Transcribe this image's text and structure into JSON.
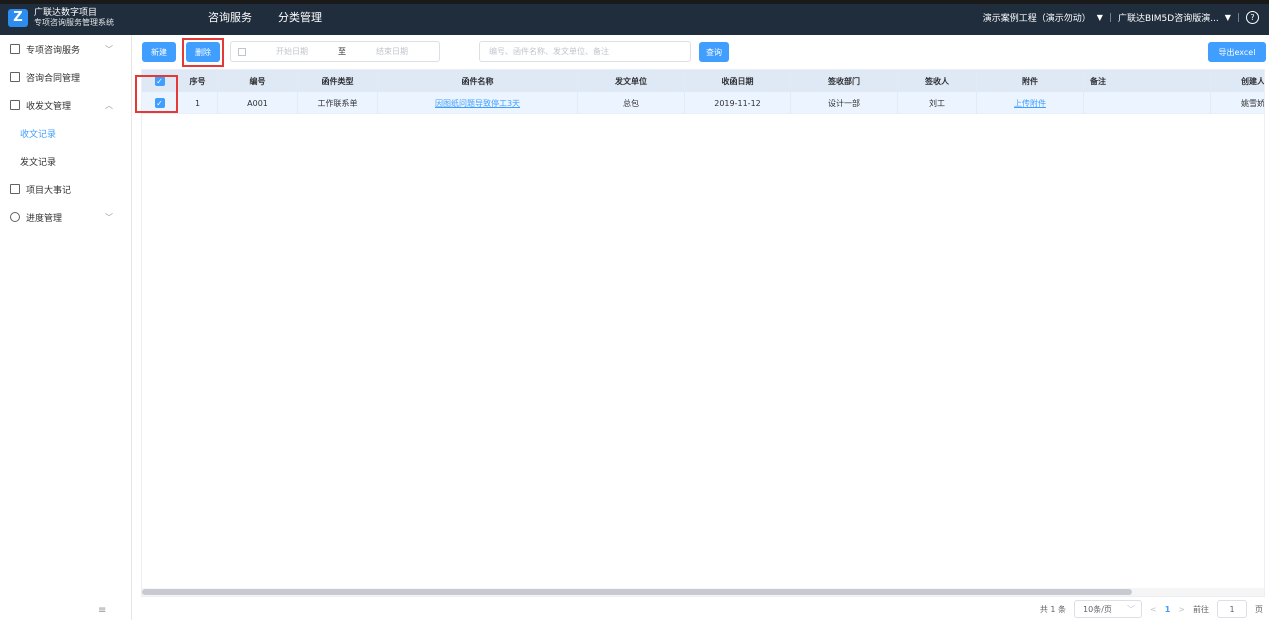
{
  "header": {
    "logo_glyph": "Z",
    "logo_line1": "广联达数字项目",
    "logo_line2": "专项咨询服务管理系统",
    "nav": [
      "咨询服务",
      "分类管理"
    ],
    "project": "演示案例工程（演示勿动）",
    "company": "广联达BIM5D咨询版演...",
    "divider": "|",
    "help": "?"
  },
  "sidebar": {
    "items": [
      {
        "label": "专项咨询服务",
        "icon": "document-icon",
        "arrow": "﹀"
      },
      {
        "label": "咨询合同管理",
        "icon": "contract-icon"
      },
      {
        "label": "收发文管理",
        "icon": "mail-icon",
        "arrow": "︿"
      },
      {
        "label": "项目大事记",
        "icon": "notes-icon"
      },
      {
        "label": "进度管理",
        "icon": "clock-icon",
        "arrow": "﹀"
      }
    ],
    "sub_items": [
      "收文记录",
      "发文记录"
    ],
    "collapse": "≡"
  },
  "toolbar": {
    "new_label": "新建",
    "delete_label": "删除",
    "start_date_placeholder": "开始日期",
    "range_sep": "至",
    "end_date_placeholder": "结束日期",
    "search_placeholder": "编号、函件名称、发文单位、备注",
    "query_label": "查询",
    "export_label": "导出excel"
  },
  "table": {
    "columns": [
      "序号",
      "编号",
      "函件类型",
      "函件名称",
      "发文单位",
      "收函日期",
      "签收部门",
      "签收人",
      "附件",
      "备注",
      "创建人"
    ],
    "rows": [
      {
        "index": "1",
        "code": "A001",
        "type": "工作联系单",
        "name": "因图纸问题导致停工3天",
        "unit": "总包",
        "date": "2019-11-12",
        "dept": "设计一部",
        "signer": "刘工",
        "attachment": "上传附件",
        "note": "",
        "creator": "姚雪娇"
      }
    ]
  },
  "pager": {
    "total": "共 1 条",
    "page_size": "10条/页",
    "prev": "<",
    "current": "1",
    "next": ">",
    "goto_label": "前往",
    "goto_value": "1",
    "page_unit": "页"
  },
  "colors": {
    "accent": "#409eff",
    "topbar": "#1f2d3d",
    "highlight": "#e53935"
  }
}
